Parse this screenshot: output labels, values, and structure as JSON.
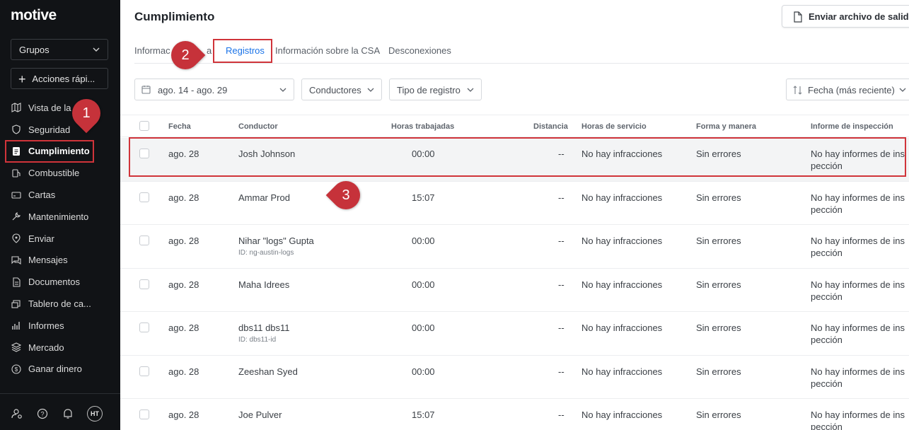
{
  "app": {
    "logo": "motive"
  },
  "sidebar": {
    "group_select": "Grupos",
    "quick_actions": "Acciones rápi...",
    "items": [
      {
        "label": "Vista de la",
        "icon": "map-icon"
      },
      {
        "label": "Seguridad",
        "icon": "shield-icon"
      },
      {
        "label": "Cumplimiento",
        "icon": "clipboard-icon",
        "active": true
      },
      {
        "label": "Combustible",
        "icon": "fuel-icon"
      },
      {
        "label": "Cartas",
        "icon": "cards-icon"
      },
      {
        "label": "Mantenimiento",
        "icon": "wrench-icon"
      },
      {
        "label": "Enviar",
        "icon": "dispatch-icon"
      },
      {
        "label": "Mensajes",
        "icon": "messages-icon"
      },
      {
        "label": "Documentos",
        "icon": "document-icon"
      },
      {
        "label": "Tablero de ca...",
        "icon": "board-icon"
      },
      {
        "label": "Informes",
        "icon": "chart-icon"
      },
      {
        "label": "Mercado",
        "icon": "layers-icon"
      },
      {
        "label": "Ganar dinero",
        "icon": "dollar-icon"
      }
    ],
    "avatar": "HT"
  },
  "header": {
    "title": "Cumplimiento",
    "export_button": "Enviar archivo de salida"
  },
  "tabs": [
    {
      "label": "Informac"
    },
    {
      "label": "a"
    },
    {
      "label": "Registros",
      "active": true
    },
    {
      "label": "Información sobre la CSA"
    },
    {
      "label": "Desconexiones"
    }
  ],
  "filters": {
    "date_range": "ago. 14 - ago. 29",
    "drivers": "Conductores",
    "log_type": "Tipo de registro",
    "sort": "Fecha (más reciente)"
  },
  "table": {
    "columns": [
      "Fecha",
      "Conductor",
      "Horas trabajadas",
      "Distancia",
      "Horas de servicio",
      "Forma y manera",
      "Informe de inspección"
    ],
    "rows": [
      {
        "date": "ago. 28",
        "driver": "Josh Johnson",
        "driver_id": "",
        "hours": "00:00",
        "distance": "--",
        "hos": "No hay infracciones",
        "form": "Sin errores",
        "inspection": "No hay informes de ins pección"
      },
      {
        "date": "ago. 28",
        "driver": "Ammar Prod",
        "driver_id": "",
        "hours": "15:07",
        "distance": "--",
        "hos": "No hay infracciones",
        "form": "Sin errores",
        "inspection": "No hay informes de ins pección"
      },
      {
        "date": "ago. 28",
        "driver": "Nihar \"logs\" Gupta",
        "driver_id": "ID: ng-austin-logs",
        "hours": "00:00",
        "distance": "--",
        "hos": "No hay infracciones",
        "form": "Sin errores",
        "inspection": "No hay informes de ins pección"
      },
      {
        "date": "ago. 28",
        "driver": "Maha Idrees",
        "driver_id": "",
        "hours": "00:00",
        "distance": "--",
        "hos": "No hay infracciones",
        "form": "Sin errores",
        "inspection": "No hay informes de ins pección"
      },
      {
        "date": "ago. 28",
        "driver": "dbs11 dbs11",
        "driver_id": "ID: dbs11-id",
        "hours": "00:00",
        "distance": "--",
        "hos": "No hay infracciones",
        "form": "Sin errores",
        "inspection": "No hay informes de ins pección"
      },
      {
        "date": "ago. 28",
        "driver": "Zeeshan Syed",
        "driver_id": "",
        "hours": "00:00",
        "distance": "--",
        "hos": "No hay infracciones",
        "form": "Sin errores",
        "inspection": "No hay informes de ins pección"
      },
      {
        "date": "ago. 28",
        "driver": "Joe Pulver",
        "driver_id": "",
        "hours": "15:07",
        "distance": "--",
        "hos": "No hay infracciones",
        "form": "Sin errores",
        "inspection": "No hay informes de ins pección"
      }
    ]
  },
  "annotations": {
    "marker1": "1",
    "marker2": "2",
    "marker3": "3",
    "color": "#c6323a"
  }
}
